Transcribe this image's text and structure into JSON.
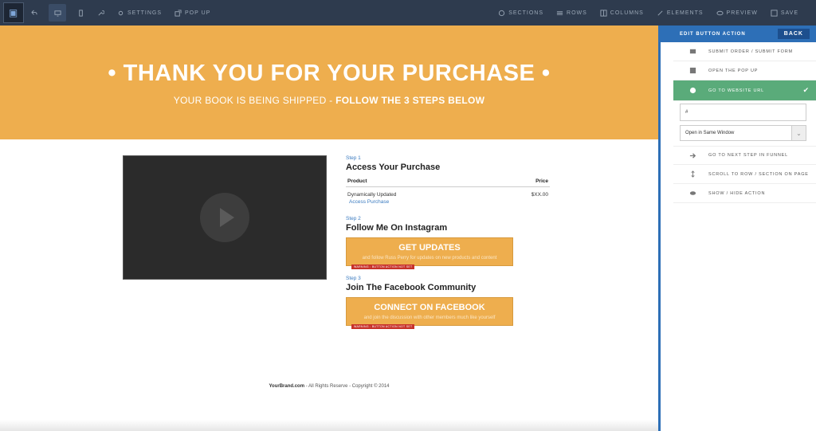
{
  "topbar": {
    "settings_label": "SETTINGS",
    "popup_label": "POP UP",
    "sections_label": "SECTIONS",
    "rows_label": "ROWS",
    "columns_label": "COLUMNS",
    "elements_label": "ELEMENTS",
    "preview_label": "PREVIEW",
    "save_label": "SAVE"
  },
  "hero": {
    "title": "• THANK YOU FOR YOUR PURCHASE •",
    "subtitle_plain": "YOUR BOOK IS BEING SHIPPED - ",
    "subtitle_bold": "FOLLOW THE 3 STEPS BELOW"
  },
  "steps": {
    "step1_label": "Step 1",
    "step1_title": "Access Your Purchase",
    "table_header_product": "Product",
    "table_header_price": "Price",
    "product_name": "Dynamically Updated",
    "product_price": "$XX.00",
    "access_link": "Access Purchase",
    "step2_label": "Step 2",
    "step2_title": "Follow Me On Instagram",
    "step2_button": "GET UPDATES",
    "step2_button_sub": "and follow Russ Perry for updates on new products and content",
    "step3_label": "Step 3",
    "step3_title": "Join The Facebook Community",
    "step3_button": "CONNECT ON FACEBOOK",
    "step3_button_sub": "and join the discussion with other members much like yourself",
    "warning_text": "WARNING : BUTTON ACTION NOT SET"
  },
  "footer": {
    "brand": "YourBrand.com",
    "rest": " - All Rights Reserve - Copyright © 2014"
  },
  "panel": {
    "header": "EDIT BUTTON ACTION",
    "back_label": "BACK",
    "items": [
      {
        "label": "SUBMIT ORDER / SUBMIT FORM",
        "icon": "envelope-icon"
      },
      {
        "label": "OPEN THE POP UP",
        "icon": "popup-icon"
      },
      {
        "label": "GO TO WEBSITE URL",
        "icon": "globe-icon"
      },
      {
        "label": "GO TO NEXT STEP IN FUNNEL",
        "icon": "arrow-right-icon"
      },
      {
        "label": "SCROLL TO ROW / SECTION ON PAGE",
        "icon": "scroll-icon"
      },
      {
        "label": "SHOW / HIDE ACTION",
        "icon": "eye-icon"
      }
    ],
    "url_value": "#",
    "window_select": "Open in Same Window"
  },
  "colors": {
    "hero_orange": "#eeae4e",
    "topbar": "#2e3b4e",
    "panel_blue": "#2d6fb7",
    "selected_green": "#5aab7a",
    "warning_red": "#c7322a"
  }
}
